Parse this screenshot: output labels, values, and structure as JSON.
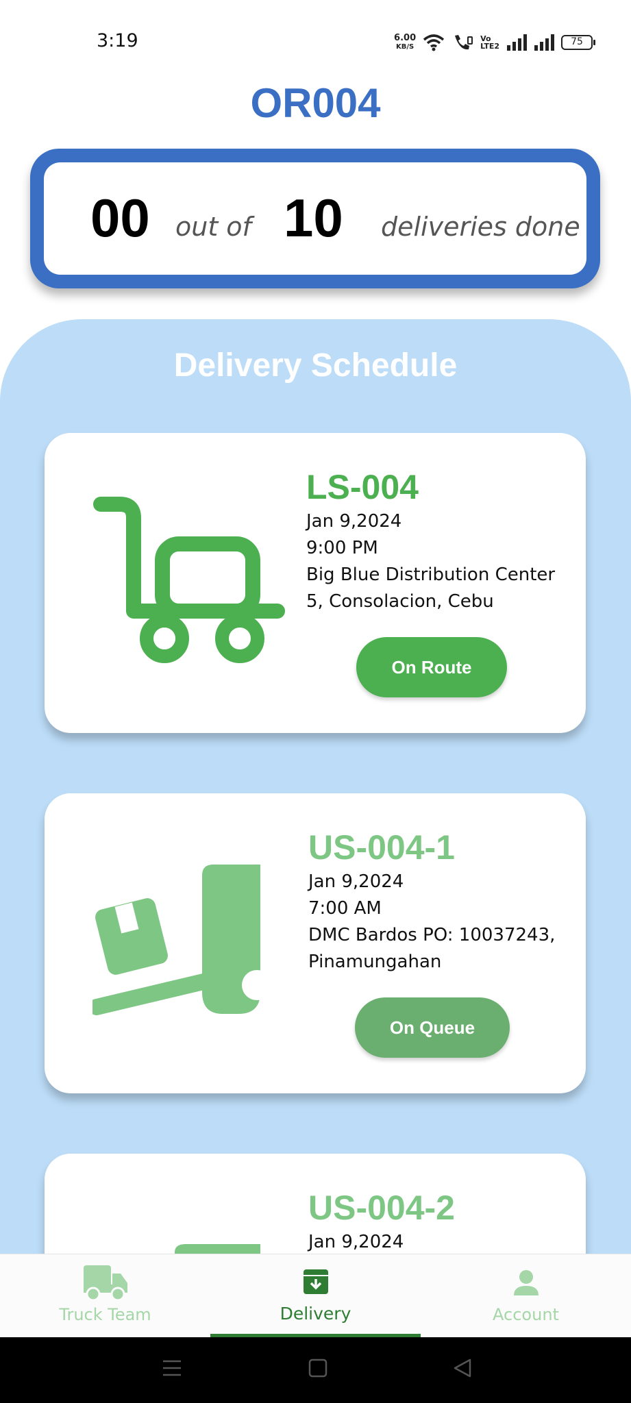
{
  "status_bar": {
    "time": "3:19",
    "net_speed": "6.00",
    "net_unit": "KB/S",
    "volte_top": "Vo",
    "volte_bottom": "LTE2",
    "battery": "75"
  },
  "header": {
    "order_id": "OR004"
  },
  "summary": {
    "done": "00",
    "out_of_label": "out of",
    "total": "10",
    "suffix_label": "deliveries done"
  },
  "schedule": {
    "title": "Delivery Schedule",
    "cards": [
      {
        "code": "LS-004",
        "date": "Jan 9,2024",
        "time": "9:00 PM",
        "location_line1": "Big Blue Distribution Center",
        "location_line2": "5, Consolacion, Cebu",
        "status": "On Route",
        "icon": "trolley-icon",
        "code_color": "#4caf50"
      },
      {
        "code": "US-004-1",
        "date": "Jan 9,2024",
        "time": "7:00 AM",
        "location_line1": "DMC Bardos PO: 10037243,",
        "location_line2": "Pinamungahan",
        "status": "On Queue",
        "icon": "hand-truck-box-icon",
        "code_color": "#7dc683"
      },
      {
        "code": "US-004-2",
        "date": "Jan 9,2024",
        "icon": "hand-truck-box-icon",
        "code_color": "#7dc683"
      }
    ]
  },
  "bottom_nav": {
    "items": [
      {
        "label": "Truck Team",
        "icon": "truck-icon",
        "active": false
      },
      {
        "label": "Delivery",
        "icon": "archive-download-icon",
        "active": true
      },
      {
        "label": "Account",
        "icon": "person-icon",
        "active": false
      }
    ],
    "active_color": "#2e7d32",
    "inactive_color": "#a5d6a7"
  },
  "colors": {
    "primary_blue": "#3a6fc4",
    "panel_blue": "#bcdcf7",
    "green": "#4caf50",
    "light_green": "#7dc683"
  }
}
